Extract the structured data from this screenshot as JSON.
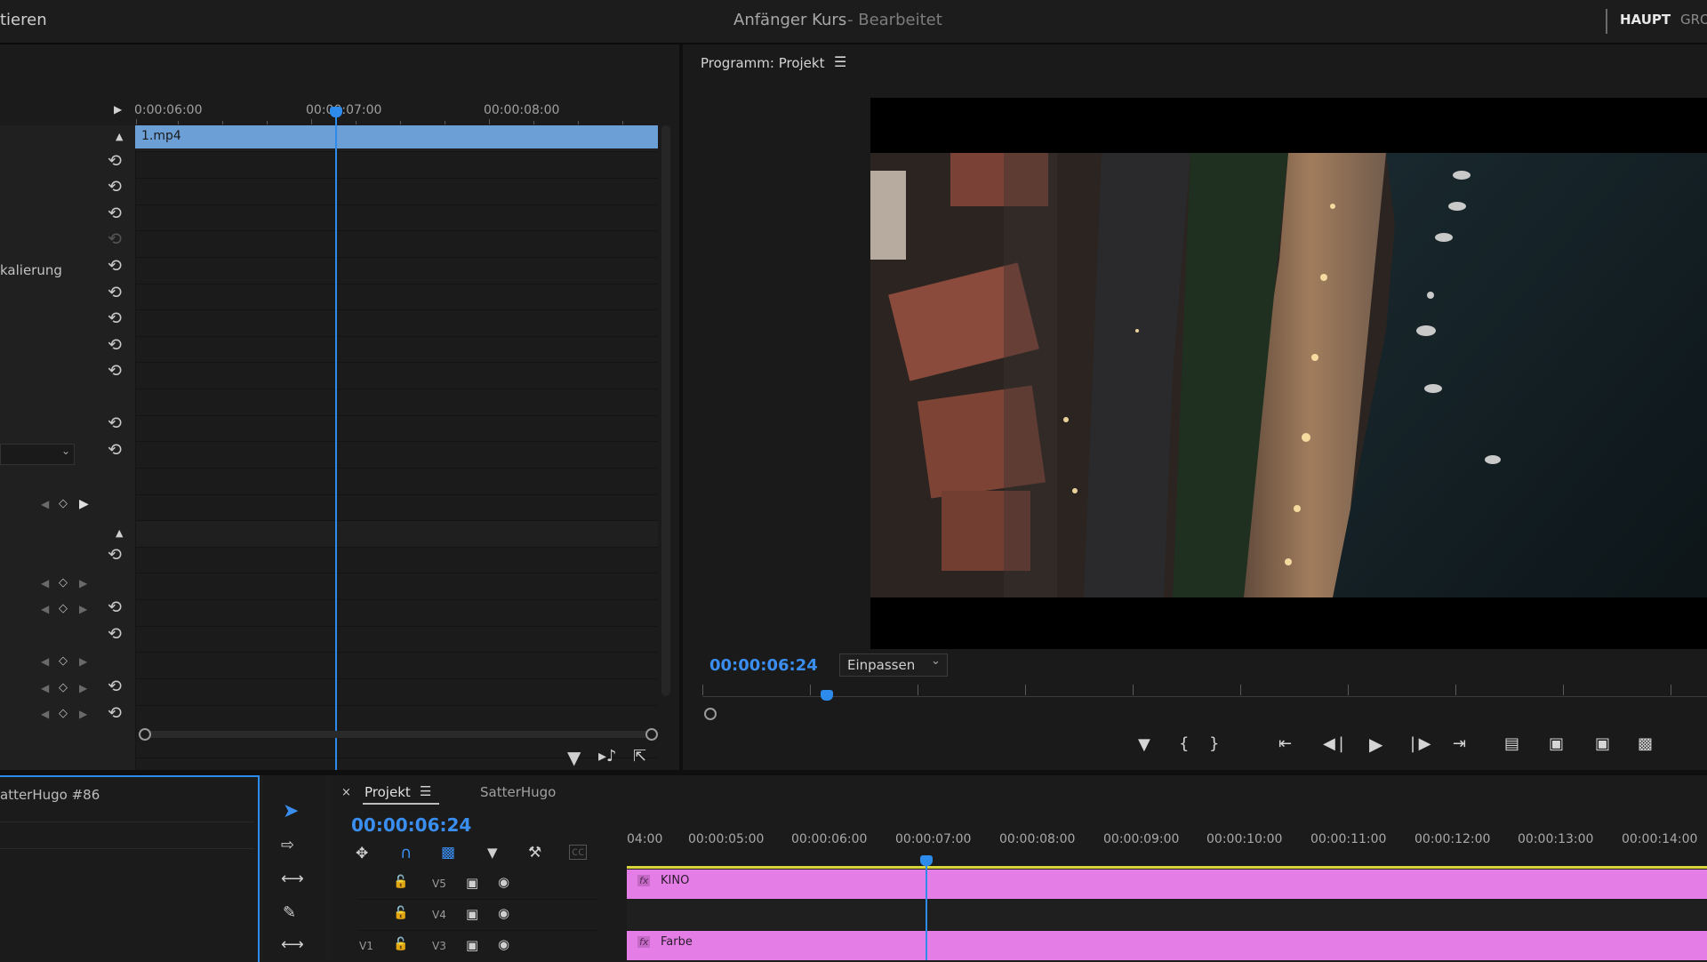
{
  "app": {
    "left_menu_fragment": "tieren",
    "project_title": "Anfänger Kurs",
    "project_status": "- Bearbeitet",
    "workspace_tab_active": "HAUPT",
    "workspace_tab_next": "GRO"
  },
  "effect_controls": {
    "ruler_times": [
      "0:00:06:00",
      "00:00:07:00",
      "00:00:08:00"
    ],
    "clip_name": "1.mp4",
    "partial_label": "kalierung"
  },
  "program_monitor": {
    "title": "Programm: Projekt",
    "timecode": "00:00:06:24",
    "fit_value": "Einpassen"
  },
  "project_panel": {
    "title": "atterHugo #86"
  },
  "timeline": {
    "tab_active": "Projekt",
    "tab_other": "SatterHugo",
    "timecode": "00:00:06:24",
    "ruler_times": [
      "04:00",
      "00:00:05:00",
      "00:00:06:00",
      "00:00:07:00",
      "00:00:08:00",
      "00:00:09:00",
      "00:00:10:00",
      "00:00:11:00",
      "00:00:12:00",
      "00:00:13:00",
      "00:00:14:00"
    ],
    "tracks": [
      {
        "label": "V5",
        "target": ""
      },
      {
        "label": "V4",
        "target": ""
      },
      {
        "label": "V3",
        "target": "V1"
      }
    ],
    "clips": [
      {
        "name": "KINO",
        "badge": "fx"
      },
      {
        "name": "Farbe",
        "badge": "fx"
      }
    ]
  },
  "colors": {
    "accent_blue": "#2d8ceb",
    "clip_blue": "#6b9fd6",
    "clip_pink": "#e47ee6",
    "timecode_blue": "#3a8ef0"
  }
}
